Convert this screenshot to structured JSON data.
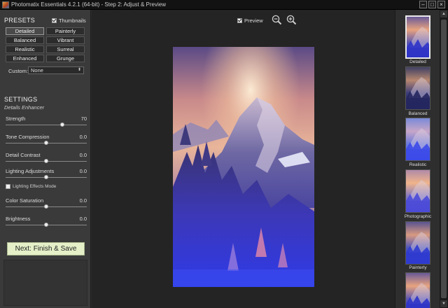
{
  "window": {
    "title": "Photomatix Essentials 4.2.1 (64-bit) - Step 2: Adjust & Preview",
    "min_glyph": "–",
    "max_glyph": "□",
    "close_glyph": "×"
  },
  "presets": {
    "title": "PRESETS",
    "thumbnails_label": "Thumbnails",
    "thumbnails_checked": true,
    "buttons": [
      "Detailed",
      "Painterly",
      "Balanced",
      "Vibrant",
      "Realistic",
      "Surreal",
      "Enhanced",
      "Grunge"
    ],
    "active": "Detailed",
    "custom_label": "Custom:",
    "custom_value": "None"
  },
  "settings": {
    "title": "SETTINGS",
    "subtitle": "Details Enhancer",
    "sliders": [
      {
        "label": "Strength",
        "value": "70",
        "level": 0.7
      },
      {
        "label": "Tone Compression",
        "value": "0.0",
        "level": 0.5
      },
      {
        "label": "Detail Contrast",
        "value": "0.0",
        "level": 0.5
      },
      {
        "label": "Lighting Adjustments",
        "value": "0.0",
        "level": 0.5
      },
      {
        "label": "Color Saturation",
        "value": "0.0",
        "level": 0.5
      },
      {
        "label": "Brightness",
        "value": "0.0",
        "level": 0.5
      }
    ],
    "lighting_effects_label": "Lighting Effects Mode",
    "lighting_effects_checked": false
  },
  "next_button": "Next: Finish & Save",
  "preview": {
    "label": "Preview",
    "checked": true
  },
  "thumbnails": [
    {
      "label": "Detailed",
      "selected": true,
      "tone": "detailed"
    },
    {
      "label": "Balanced",
      "selected": false,
      "tone": "balanced"
    },
    {
      "label": "Realistic",
      "selected": false,
      "tone": "realistic"
    },
    {
      "label": "Photographic",
      "selected": false,
      "tone": "photographic"
    },
    {
      "label": "Painterly",
      "selected": false,
      "tone": "painterly"
    },
    {
      "label": "",
      "selected": false,
      "tone": "detailed"
    }
  ]
}
